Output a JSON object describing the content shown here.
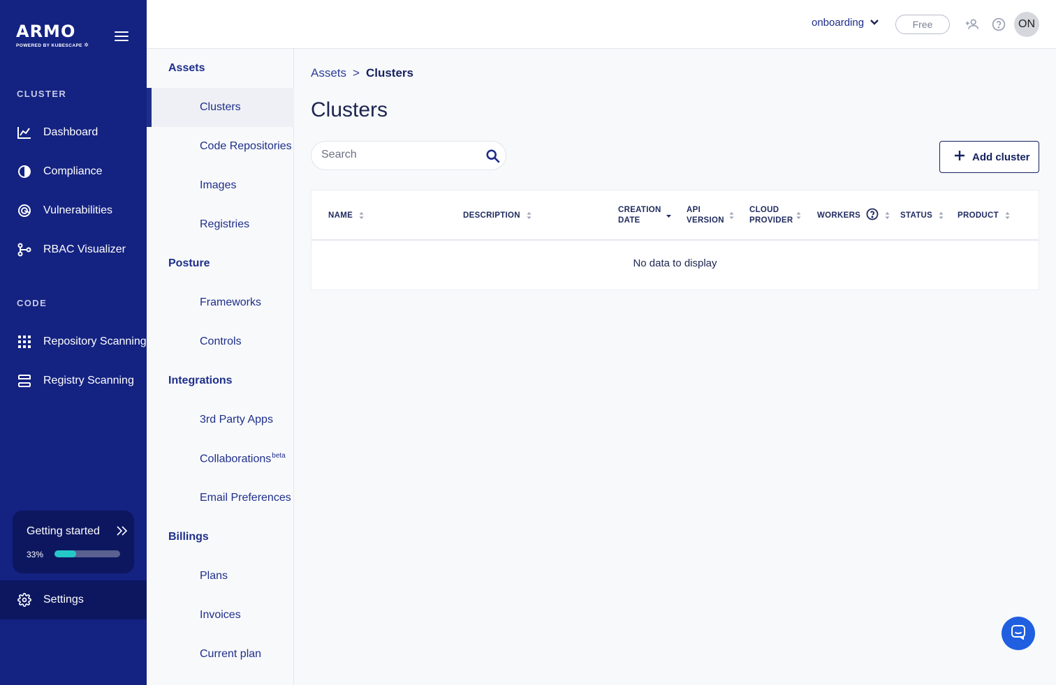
{
  "logo": {
    "wordmark": "ARMO",
    "tagline": "POWERED BY KUBESCAPE"
  },
  "sidebar": {
    "sections": [
      {
        "label": "CLUSTER",
        "items": [
          {
            "label": "Dashboard",
            "icon": "chart-icon"
          },
          {
            "label": "Compliance",
            "icon": "compliance-icon"
          },
          {
            "label": "Vulnerabilities",
            "icon": "vulnerabilities-icon"
          },
          {
            "label": "RBAC Visualizer",
            "icon": "rbac-icon"
          }
        ]
      },
      {
        "label": "CODE",
        "items": [
          {
            "label": "Repository Scanning",
            "icon": "repository-icon"
          },
          {
            "label": "Registry Scanning",
            "icon": "registry-icon"
          }
        ]
      }
    ],
    "getting_started": {
      "label": "Getting started",
      "progress_text": "33%",
      "progress": 0.33
    },
    "settings_label": "Settings"
  },
  "topbar": {
    "org_name": "onboarding",
    "plan_badge": "Free",
    "avatar_initials": "ON"
  },
  "submenu": {
    "groups": [
      {
        "header": "Assets",
        "items": [
          "Clusters",
          "Code Repositories",
          "Images",
          "Registries"
        ]
      },
      {
        "header": "Posture",
        "items": [
          "Frameworks",
          "Controls"
        ]
      },
      {
        "header": "Integrations",
        "items": [
          "3rd Party Apps",
          "Collaborations",
          "Email Preferences"
        ]
      },
      {
        "header": "Billings",
        "items": [
          "Plans",
          "Invoices",
          "Current plan"
        ]
      }
    ],
    "collaborations_badge": "beta",
    "active_item": "Clusters"
  },
  "breadcrumb": {
    "parent": "Assets",
    "separator": ">",
    "current": "Clusters"
  },
  "page_title": "Clusters",
  "search": {
    "placeholder": "Search",
    "value": ""
  },
  "add_button": "Add cluster",
  "table": {
    "columns": [
      "NAME",
      "DESCRIPTION",
      "CREATION DATE",
      "API VERSION",
      "CLOUD PROVIDER",
      "WORKERS",
      "STATUS",
      "PRODUCT"
    ],
    "empty_text": "No data to display"
  },
  "colors": {
    "sidebar_bg": "#142281",
    "accent": "#1e2f8a",
    "progress": "#24c8c8",
    "chat": "#1f5fe0"
  }
}
